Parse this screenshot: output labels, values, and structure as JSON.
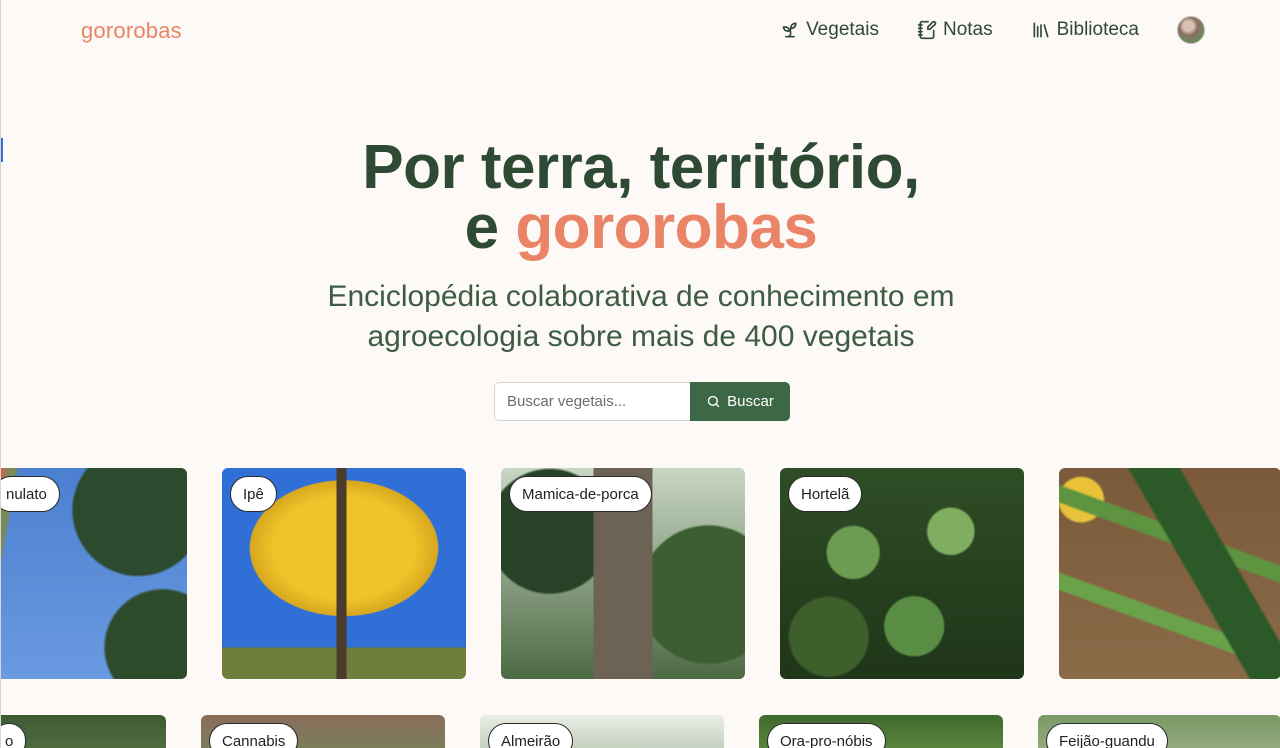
{
  "header": {
    "logo": "gororobas",
    "nav": [
      {
        "label": "Vegetais",
        "icon": "sprout-icon"
      },
      {
        "label": "Notas",
        "icon": "notes-icon"
      },
      {
        "label": "Biblioteca",
        "icon": "library-icon"
      }
    ],
    "avatar_icon": "user-avatar"
  },
  "hero": {
    "title_line1": "Por terra, território,",
    "title_line2_prefix": "e",
    "title_line2_accent": "gororobas",
    "subtitle_line1": "Enciclopédia colaborativa de conhecimento em",
    "subtitle_line2": "agroecologia sobre mais de 400 vegetais"
  },
  "search": {
    "placeholder": "Buscar vegetais...",
    "button_label": "Buscar",
    "button_icon": "search-icon"
  },
  "cards_row1": [
    {
      "label": "nulato"
    },
    {
      "label": "Ipê"
    },
    {
      "label": "Mamica-de-porca"
    },
    {
      "label": "Hortelã"
    },
    {
      "label": ""
    }
  ],
  "cards_row2": [
    {
      "label": "o"
    },
    {
      "label": "Cannabis"
    },
    {
      "label": "Almeirão"
    },
    {
      "label": "Ora-pro-nóbis"
    },
    {
      "label": "Feijão-guandu"
    }
  ],
  "colors": {
    "brand_accent": "#e98466",
    "primary_green": "#2f4a34",
    "button_green": "#3d6846",
    "background": "#fcf9f6"
  }
}
